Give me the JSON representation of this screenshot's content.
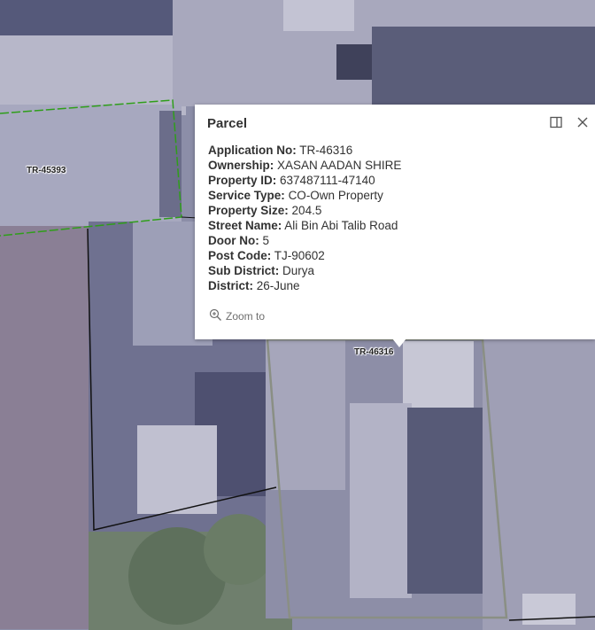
{
  "map": {
    "parcel_labels": [
      "TR-45393",
      "TR-46316"
    ]
  },
  "popup": {
    "title": "Parcel",
    "fields": [
      {
        "label": "Application No:",
        "value": "TR-46316"
      },
      {
        "label": "Ownership:",
        "value": "XASAN AADAN SHIRE"
      },
      {
        "label": "Property ID:",
        "value": "637487111-47140"
      },
      {
        "label": "Service Type:",
        "value": "CO-Own Property"
      },
      {
        "label": "Property Size:",
        "value": "204.5"
      },
      {
        "label": "Street Name:",
        "value": "Ali Bin Abi Talib Road"
      },
      {
        "label": "Door No:",
        "value": "5"
      },
      {
        "label": "Post Code:",
        "value": "TJ-90602"
      },
      {
        "label": "Sub District:",
        "value": "Durya"
      },
      {
        "label": "District:",
        "value": "26-June"
      }
    ],
    "zoom_to_label": "Zoom to",
    "dock_icon": "dock-icon",
    "close_icon": "close-icon",
    "zoom_icon": "zoom-in-icon"
  },
  "colors": {
    "selected_parcel_outline": "#2f9e1a",
    "parcel_outline": "#111111",
    "highlight_parcel_outline": "#8a8f84"
  }
}
